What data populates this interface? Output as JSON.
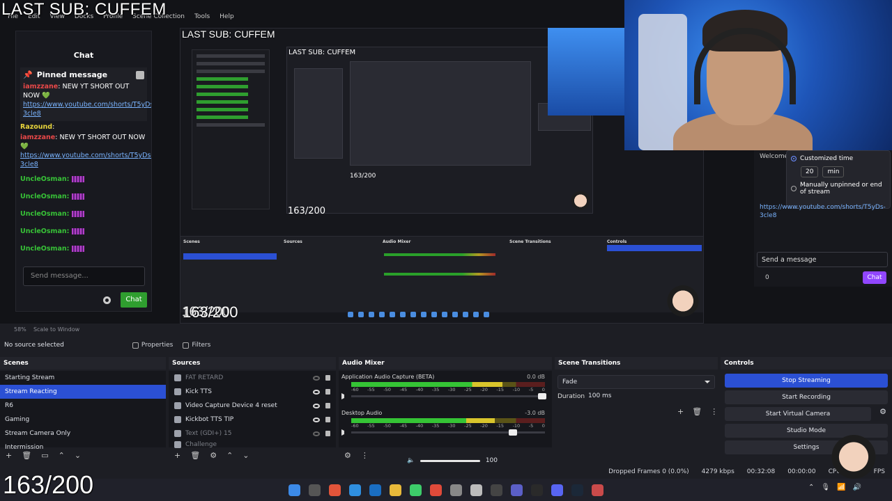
{
  "overlay": {
    "title": "LAST SUB: CUFFEM",
    "counter": "163/200"
  },
  "menu": [
    "File",
    "Edit",
    "View",
    "Docks",
    "Profile",
    "Scene Collection",
    "Tools",
    "Help"
  ],
  "chat": {
    "header": "Chat",
    "pinned_title": "Pinned message",
    "pinned_user": "iamzzane",
    "pinned_text": "NEW YT SHORT OUT NOW 💚",
    "pinned_link": "https://www.youtube.com/shorts/T5yDs-3cle8",
    "user2": "Razound",
    "msg_user": "iamzzane",
    "msg_text": "NEW YT SHORT OUT NOW 💚",
    "msg_link": "https://www.youtube.com/shorts/T5yDs-3cle8",
    "repeat_user": "UncleOsman:",
    "input_placeholder": "Send message...",
    "send_label": "Chat"
  },
  "nested": {
    "title": "LAST SUB: CUFFEM",
    "inner_title": "LAST SUB: CUFFEM",
    "counter_small": "163/200",
    "counter_mid": "163/200",
    "no_source": "No source selected",
    "scenes_head": "Scenes",
    "sources_head": "Sources",
    "mixer_head": "Audio Mixer",
    "transitions_head": "Scene Transitions",
    "controls_head": "Controls"
  },
  "right_chat": {
    "welcome": "Welcome",
    "opt_custom": "Customized time",
    "time_value": "20",
    "time_unit": "min",
    "opt_manual": "Manually unpinned or end of stream",
    "link": "https://www.youtube.com/shorts/T5yDs-3cle8",
    "input_placeholder": "Send a message",
    "viewer_count": "0",
    "send_label": "Chat"
  },
  "obs": {
    "zoom": "58%",
    "scale_label": "Scale to Window",
    "no_source": "No source selected",
    "properties": "Properties",
    "filters": "Filters",
    "scenes": {
      "title": "Scenes",
      "items": [
        "Starting Stream",
        "Stream Reacting",
        "R6",
        "Gaming",
        "Stream Camera Only",
        "Intermission"
      ],
      "active_index": 1
    },
    "sources": {
      "title": "Sources",
      "items": [
        "FAT RETARD",
        "Kick TTS",
        "Video Capture Device 4 reset",
        "Kickbot TTS TIP",
        "Text (GDI+) 15",
        "Challenge"
      ]
    },
    "mixer": {
      "title": "Audio Mixer",
      "ch1_name": "Application Audio Capture (BETA)",
      "ch1_db": "0.0 dB",
      "ch1_level": 0.78,
      "ch2_name": "Desktop Audio",
      "ch2_db": "-3.0 dB",
      "ch2_level": 0.74,
      "ticks": [
        "-60",
        "-55",
        "-50",
        "-45",
        "-40",
        "-35",
        "-30",
        "-25",
        "-20",
        "-15",
        "-10",
        "-5",
        "0"
      ]
    },
    "transitions": {
      "title": "Scene Transitions",
      "selected": "Fade",
      "duration_label": "Duration",
      "duration_value": "100 ms"
    },
    "controls": {
      "title": "Controls",
      "buttons": [
        "Stop Streaming",
        "Start Recording",
        "Start Virtual Camera",
        "Studio Mode",
        "Settings"
      ]
    },
    "volume": "100",
    "status": {
      "dropped": "Dropped Frames 0 (0.0%)",
      "bitrate": "4279 kbps",
      "stream_time": "00:32:08",
      "rec_time": "00:00:00",
      "cpu": "CPU: 3.4%",
      "fps": "FPS"
    }
  },
  "colors": {
    "accent": "#2b50d4",
    "chat_green": "#2f9e2f",
    "twitch_purple": "#9146ff"
  }
}
